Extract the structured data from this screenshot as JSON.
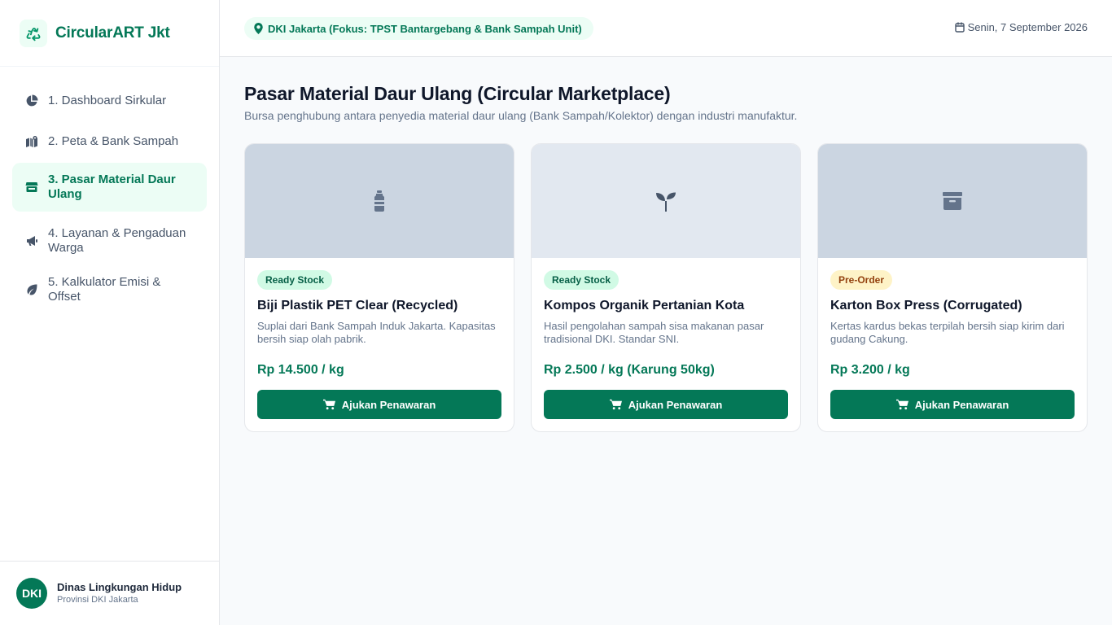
{
  "brand": {
    "name": "CircularART Jkt",
    "icon": "recycle-icon",
    "accent": "#047857"
  },
  "nav": {
    "items": [
      {
        "label": "1. Dashboard Sirkular",
        "icon": "chart-pie-icon"
      },
      {
        "label": "2. Peta & Bank Sampah",
        "icon": "map-location-icon"
      },
      {
        "label": "3. Pasar Material Daur Ulang",
        "icon": "store-icon",
        "active": true
      },
      {
        "label": "4. Layanan & Pengaduan Warga",
        "icon": "bullhorn-icon"
      },
      {
        "label": "5. Kalkulator Emisi & Offset",
        "icon": "leaf-icon"
      }
    ]
  },
  "footer": {
    "avatar": "DKI",
    "title": "Dinas Lingkungan Hidup",
    "subtitle": "Provinsi DKI Jakarta"
  },
  "header": {
    "location": "DKI Jakarta (Fokus: TPST Bantargebang & Bank Sampah Unit)",
    "date": "Senin, 7 September 2026"
  },
  "page": {
    "title": "Pasar Material Daur Ulang (Circular Marketplace)",
    "subtitle": "Bursa penghubung antara penyedia material daur ulang (Bank Sampah/Kolektor) dengan industri manufaktur."
  },
  "products": [
    {
      "badge": "Ready Stock",
      "title": "Biji Plastik PET Clear (Recycled)",
      "description": "Suplai dari Bank Sampah Induk Jakarta. Kapasitas bersih siap olah pabrik.",
      "price": "Rp 14.500 / kg",
      "button": "Ajukan Penawaran",
      "image_icon": "bottle-icon"
    },
    {
      "badge": "Ready Stock",
      "title": "Kompos Organik Pertanian Kota",
      "description": "Hasil pengolahan sampah sisa makanan pasar tradisional DKI. Standar SNI.",
      "price": "Rp 2.500 / kg (Karung 50kg)",
      "button": "Ajukan Penawaran",
      "image_icon": "seedling-icon"
    },
    {
      "badge": "Pre-Order",
      "title": "Karton Box Press (Corrugated)",
      "description": "Kertas kardus bekas terpilah bersih siap kirim dari gudang Cakung.",
      "price": "Rp 3.200 / kg",
      "button": "Ajukan Penawaran",
      "image_icon": "archive-box-icon"
    }
  ]
}
